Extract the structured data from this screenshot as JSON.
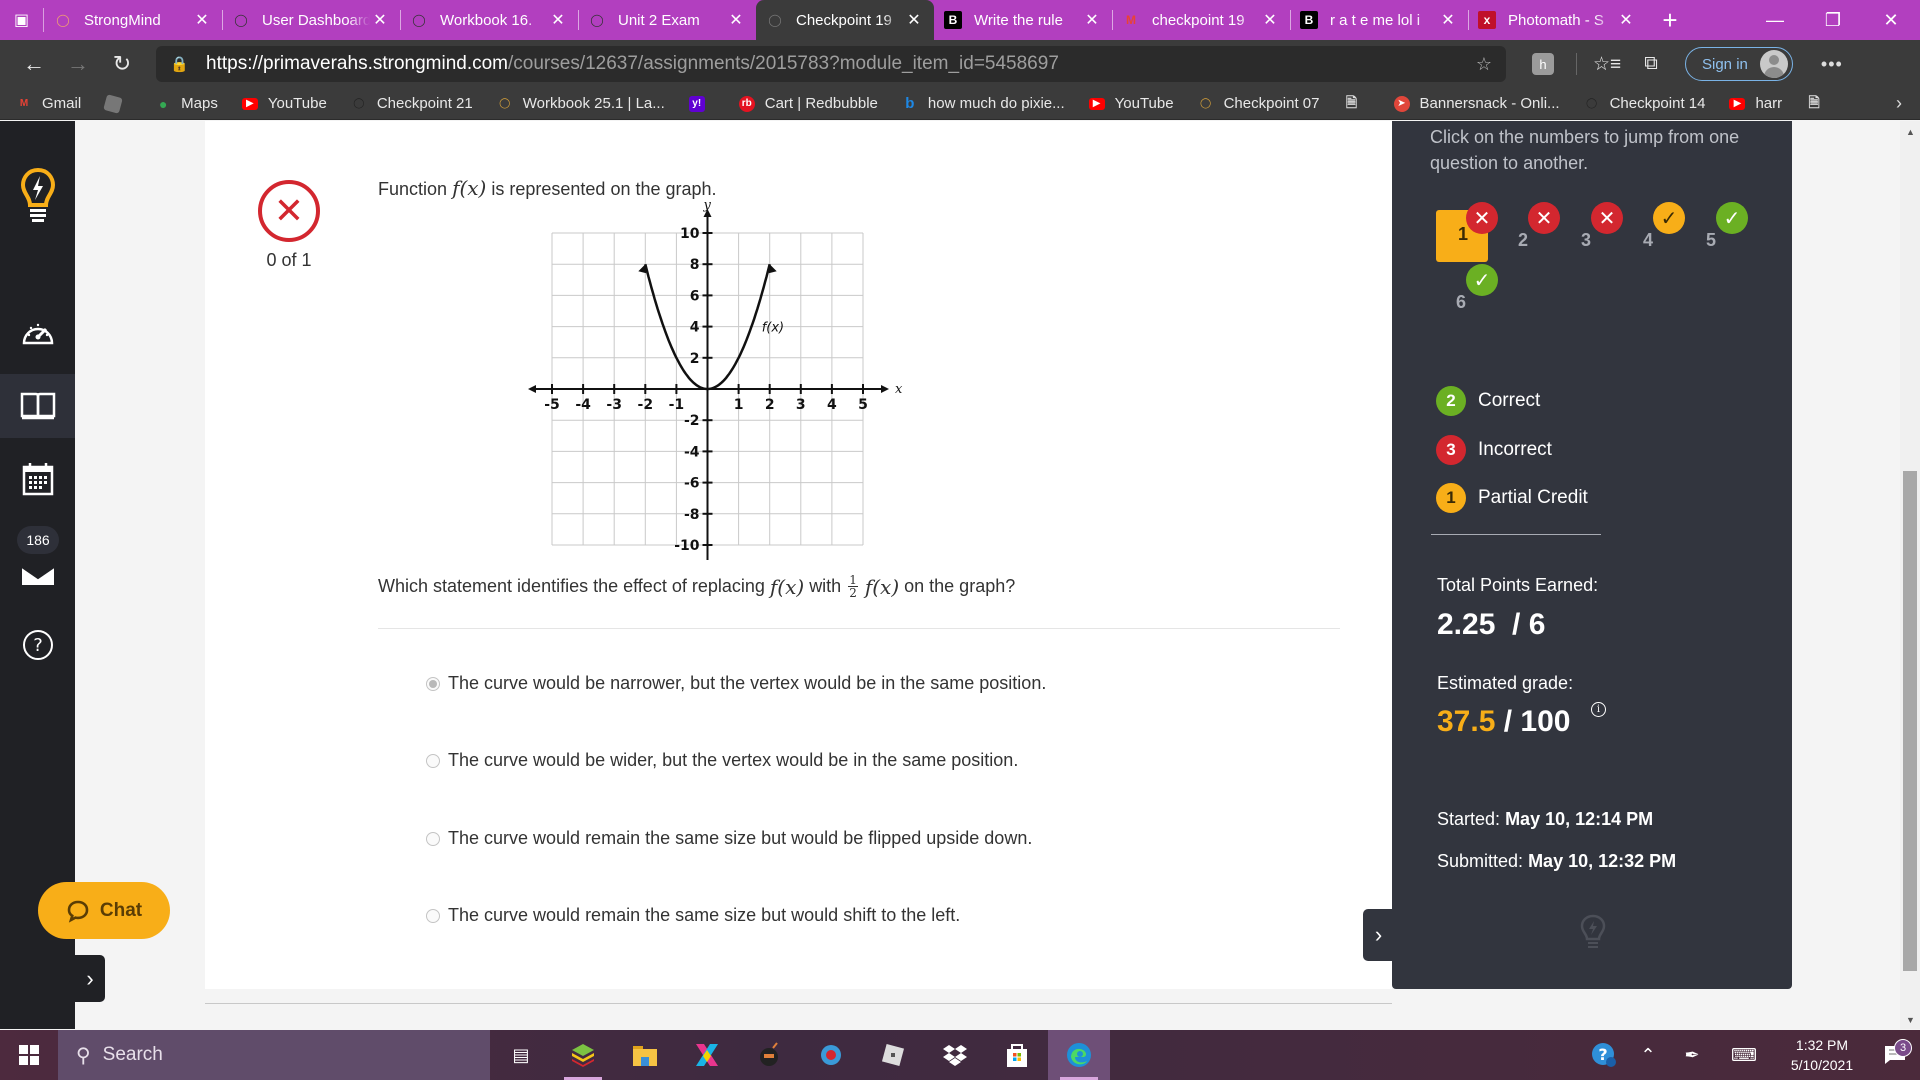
{
  "browser": {
    "tabs": [
      {
        "label": "StrongMind",
        "icon": "lightbulb-orange-icon",
        "active": false
      },
      {
        "label": "User Dashboard",
        "icon": "lightbulb-icon",
        "active": false
      },
      {
        "label": "Workbook 16.",
        "icon": "lightbulb-icon",
        "active": false
      },
      {
        "label": "Unit 2 Exam",
        "icon": "lightbulb-icon",
        "active": false
      },
      {
        "label": "Checkpoint 19",
        "icon": "lightbulb-icon",
        "active": true
      },
      {
        "label": "Write the rule",
        "icon": "brainly-icon",
        "active": false
      },
      {
        "label": "checkpoint 19",
        "icon": "gmail-icon",
        "active": false
      },
      {
        "label": "r a t e me lol i",
        "icon": "brainly-icon",
        "active": false
      },
      {
        "label": "Photomath - S",
        "icon": "photomath-icon",
        "active": false
      }
    ],
    "new_tab_glyph": "+",
    "url_host": "https://primaverahs.strongmind.com",
    "url_path": "/courses/12637/assignments/2015783?module_item_id=5458697",
    "extension_letter": "h",
    "sign_in_label": "Sign in",
    "bookmarks": [
      {
        "label": "Gmail",
        "icon": "gmail-icon"
      },
      {
        "label": "",
        "icon": "roblox-icon"
      },
      {
        "label": "Maps",
        "icon": "maps-icon"
      },
      {
        "label": "YouTube",
        "icon": "youtube-icon"
      },
      {
        "label": "Checkpoint 21",
        "icon": "lightbulb-icon"
      },
      {
        "label": "Workbook 25.1 | La...",
        "icon": "lightbulb-orange-icon"
      },
      {
        "label": "",
        "icon": "yahoo-icon"
      },
      {
        "label": "Cart | Redbubble",
        "icon": "redbubble-icon"
      },
      {
        "label": "how much do pixie...",
        "icon": "bing-icon"
      },
      {
        "label": "YouTube",
        "icon": "youtube-icon"
      },
      {
        "label": "Checkpoint 07",
        "icon": "lightbulb-orange-icon"
      },
      {
        "label": "",
        "icon": "page-icon"
      },
      {
        "label": "Bannersnack - Onli...",
        "icon": "bannersnack-icon"
      },
      {
        "label": "Checkpoint 14",
        "icon": "lightbulb-icon"
      },
      {
        "label": "harr",
        "icon": "youtube-icon"
      },
      {
        "label": "",
        "icon": "page-icon"
      }
    ]
  },
  "leftnav": {
    "items": [
      {
        "name": "dashboard",
        "icon": "speedometer-icon"
      },
      {
        "name": "courses",
        "icon": "open-book-icon",
        "active": true
      },
      {
        "name": "calendar",
        "icon": "calendar-icon"
      },
      {
        "name": "inbox",
        "icon": "mail-icon",
        "badge": "186"
      },
      {
        "name": "help",
        "icon": "help-icon"
      }
    ]
  },
  "question": {
    "result_status": "incorrect",
    "score": "0 of 1",
    "intro_before": "Function",
    "intro_math": "f(x)",
    "intro_after": "is represented on the graph.",
    "prompt_before": "Which statement identifies the effect of replacing",
    "prompt_math1": "f(x)",
    "prompt_with": "with",
    "prompt_frac_num": "1",
    "prompt_frac_den": "2",
    "prompt_math2": "f(x)",
    "prompt_after": "on the graph?",
    "options": [
      {
        "label": "The curve would be narrower, but the vertex would be in the same position.",
        "selected": true
      },
      {
        "label": "The curve would be wider, but the vertex would be in the same position.",
        "selected": false
      },
      {
        "label": "The curve would remain the same size but would be flipped upside down.",
        "selected": false
      },
      {
        "label": "The curve would remain the same size but would shift to the left.",
        "selected": false
      }
    ]
  },
  "chart_data": {
    "type": "line",
    "title": "",
    "xlabel": "x",
    "ylabel": "y",
    "xlim": [
      -5,
      5
    ],
    "ylim": [
      -10,
      10
    ],
    "grid": true,
    "x_ticks": [
      -5,
      -4,
      -3,
      -2,
      -1,
      1,
      2,
      3,
      4,
      5
    ],
    "y_ticks": [
      10,
      8,
      6,
      4,
      2,
      -2,
      -4,
      -6,
      -8,
      -10
    ],
    "series": [
      {
        "name": "f(x)",
        "function": "2x^2",
        "domain": [
          -2,
          2
        ],
        "arrows": true,
        "points": [
          [
            -2,
            8
          ],
          [
            -1.5,
            4.5
          ],
          [
            -1,
            2
          ],
          [
            -0.5,
            0.5
          ],
          [
            0,
            0
          ],
          [
            0.5,
            0.5
          ],
          [
            1,
            2
          ],
          [
            1.5,
            4.5
          ],
          [
            2,
            8
          ]
        ]
      }
    ],
    "annotations": [
      {
        "text": "f(x)",
        "x": 2,
        "y": 4
      }
    ]
  },
  "chat": {
    "label": "Chat"
  },
  "summary": {
    "instructions": "Click on the numbers to jump from one question to another.",
    "questions": [
      {
        "number": "1",
        "status": "incorrect",
        "current": true
      },
      {
        "number": "2",
        "status": "incorrect",
        "current": false
      },
      {
        "number": "3",
        "status": "incorrect",
        "current": false
      },
      {
        "number": "4",
        "status": "partial",
        "current": false
      },
      {
        "number": "5",
        "status": "correct",
        "current": false
      },
      {
        "number": "6",
        "status": "correct",
        "current": false
      }
    ],
    "legend": [
      {
        "count": "2",
        "label": "Correct",
        "color": "#6bb023"
      },
      {
        "count": "3",
        "label": "Incorrect",
        "color": "#d3272f"
      },
      {
        "count": "1",
        "label": "Partial Credit",
        "color": "#f8ae18"
      }
    ],
    "points_label": "Total Points Earned:",
    "points_value": "2.25  / 6",
    "grade_label": "Estimated grade:",
    "grade_value": "37.5",
    "grade_total": " / 100",
    "started_label": "Started:",
    "started_value": "May 10, 12:14 PM",
    "submitted_label": "Submitted:",
    "submitted_value": "May 10, 12:32 PM"
  },
  "taskbar": {
    "search_label": "Search",
    "time": "1:32 PM",
    "date": "5/10/2021",
    "notification_count": "3",
    "apps": [
      "task-view-icon",
      "bluestacks-icon",
      "file-explorer-icon",
      "app-x-icon",
      "game-icon",
      "game-2-icon",
      "roblox-icon",
      "dropbox-icon",
      "store-icon",
      "edge-icon"
    ]
  },
  "colors": {
    "accent": "#f8ae18",
    "incorrect": "#d3272f",
    "correct": "#6bb023",
    "panel": "#32353e",
    "tabbar": "#b23fbf"
  }
}
